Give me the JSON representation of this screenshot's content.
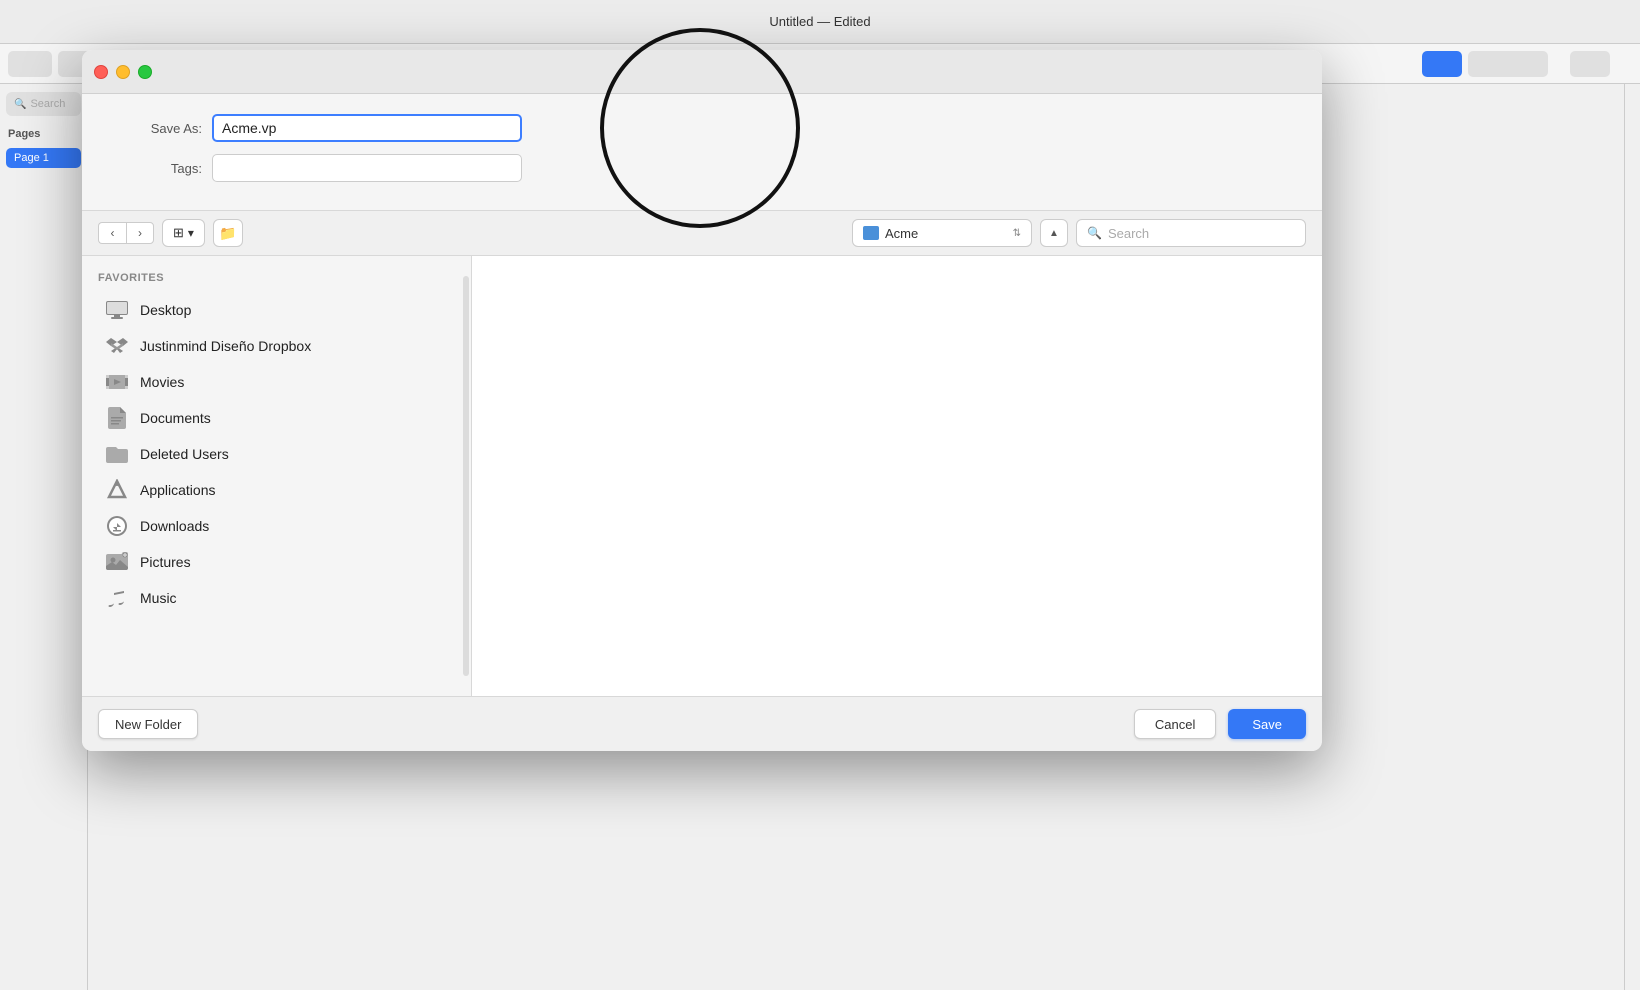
{
  "app": {
    "title": "Untitled — Edited"
  },
  "dialog": {
    "save_as_label": "Save As:",
    "tags_label": "Tags:",
    "save_as_value": "Acme.vp",
    "tags_value": "",
    "location": "Acme",
    "search_placeholder": "Search",
    "new_folder_label": "New Folder",
    "cancel_label": "Cancel",
    "save_label": "Save"
  },
  "sidebar": {
    "favorites_title": "Favorites",
    "items": [
      {
        "id": "desktop",
        "label": "Desktop",
        "icon": "🖥"
      },
      {
        "id": "dropbox",
        "label": "Justinmind Diseño Dropbox",
        "icon": "📦"
      },
      {
        "id": "movies",
        "label": "Movies",
        "icon": "🎞"
      },
      {
        "id": "documents",
        "label": "Documents",
        "icon": "📄"
      },
      {
        "id": "deleted-users",
        "label": "Deleted Users",
        "icon": "📁"
      },
      {
        "id": "applications",
        "label": "Applications",
        "icon": "🅐"
      },
      {
        "id": "downloads",
        "label": "Downloads",
        "icon": "⬇"
      },
      {
        "id": "pictures",
        "label": "Pictures",
        "icon": "📷"
      },
      {
        "id": "music",
        "label": "Music",
        "icon": "🎵"
      }
    ]
  },
  "left_sidebar": {
    "search_placeholder": "Search",
    "section_title": "Pages",
    "page_item": "Page 1"
  }
}
